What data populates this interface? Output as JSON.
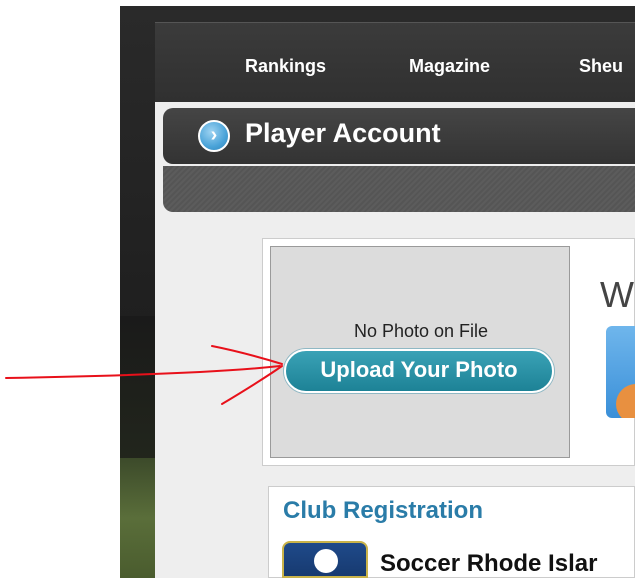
{
  "nav": {
    "items": [
      {
        "label": "Rankings"
      },
      {
        "label": "Magazine"
      },
      {
        "label": "Sheu"
      }
    ]
  },
  "header": {
    "title": "Player Account",
    "icon": "chevron-right-circle-icon",
    "accent": "#4aa3d8"
  },
  "photo": {
    "status": "No Photo on File",
    "upload_label": "Upload Your Photo",
    "button_color": "#2a94a8"
  },
  "welcome": {
    "text": "W"
  },
  "club": {
    "title": "Club Registration",
    "name": "Soccer Rhode Islar"
  },
  "annotation": {
    "color": "#e8101a",
    "icon": "hand-drawn-arrow"
  }
}
